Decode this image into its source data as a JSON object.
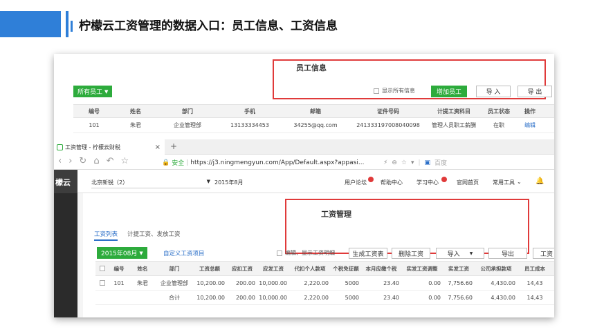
{
  "slide": {
    "title": "柠檬云工资管理的数据入口：员工信息、工资信息",
    "accent": "#2f7fd8"
  },
  "app1": {
    "title": "员工信息",
    "filter_label": "所有员工",
    "show_all_label": "显示所有信息",
    "add_button": "增加员工",
    "import_button": "导 入",
    "export_button": "导 出",
    "headers": [
      "编号",
      "姓名",
      "部门",
      "手机",
      "邮箱",
      "证件号码",
      "计提工资科目",
      "员工状态",
      "操作"
    ],
    "row": {
      "id": "101",
      "name": "朱君",
      "dept": "企业管理部",
      "phone": "13133334453",
      "email": "34255@qq.com",
      "idno": "241333197008040098",
      "subject": "管理人员职工薪酬",
      "status": "在职",
      "edit": "编辑"
    }
  },
  "browser": {
    "tab_title": "工资管理 - 柠檬云财税",
    "tab_close": "×",
    "new_tab": "+",
    "secure_label": "安全",
    "url": "https://j3.ningmengyun.com/App/Default.aspx?appasi...",
    "search_engine": "百度"
  },
  "app2": {
    "brand": "檬云",
    "company": "北京新锐（2）",
    "period": "2015年8月",
    "nav": [
      "用户论坛",
      "帮助中心",
      "学习中心",
      "官网首页",
      "常用工具"
    ],
    "title": "工资管理",
    "tabs": [
      "工资列表",
      "计提工资、发放工资"
    ],
    "month_select": "2015年08月",
    "custom_link": "自定义工资项目",
    "edit_show_label": "编辑、显示工资明细",
    "gen_button": "生成工资表",
    "del_button": "删除工资",
    "import_button": "导入",
    "export_button": "导出",
    "more_button": "工资",
    "headers": [
      "编号",
      "姓名",
      "部门",
      "工资总额",
      "应扣工资",
      "应发工资",
      "代扣个人款项",
      "个税免征额",
      "本月应缴个税",
      "实发工资调整",
      "实发工资",
      "公司承担款项",
      "员工成本"
    ],
    "row": {
      "id": "101",
      "name": "朱君",
      "dept": "企业管理部",
      "total": "10,200.00",
      "deduct": "200.00",
      "payable": "10,000.00",
      "withheld": "2,220.00",
      "exempt": "5000",
      "tax": "23.40",
      "adjust": "0.00",
      "net": "7,756.60",
      "company": "4,430.00",
      "cost": "14,43"
    },
    "total_row": {
      "label": "合计",
      "total": "10,200.00",
      "deduct": "200.00",
      "payable": "10,000.00",
      "withheld": "2,220.00",
      "exempt": "5000",
      "tax": "23.40",
      "adjust": "0.00",
      "net": "7,756.60",
      "company": "4,430.00",
      "cost": "14,43"
    }
  }
}
